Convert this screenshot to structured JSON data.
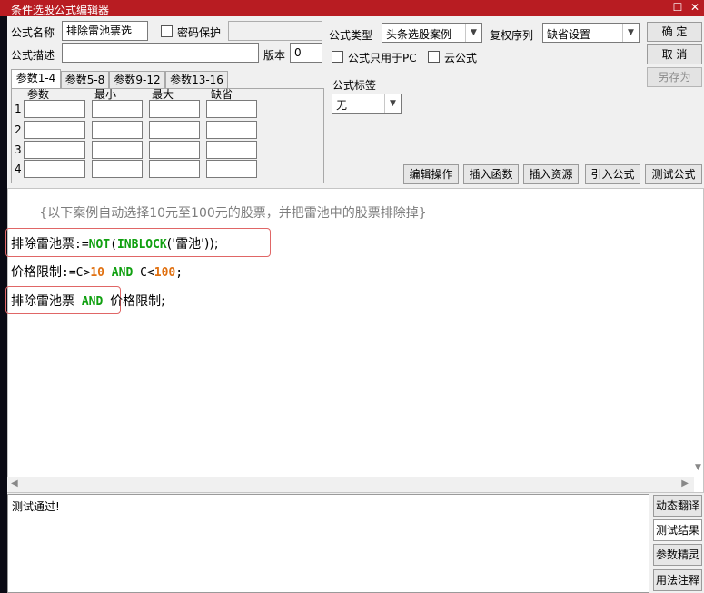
{
  "window": {
    "title": "条件选股公式编辑器",
    "restore_glyph": "☐",
    "close_glyph": "✕"
  },
  "form": {
    "name_label": "公式名称",
    "name_value": "排除雷池票选",
    "password_label": "密码保护",
    "password_value": "",
    "desc_label": "公式描述",
    "desc_value": "",
    "version_label": "版本",
    "version_value": "0",
    "type_label": "公式类型",
    "type_value": "头条选股案例",
    "rights_label": "复权序列",
    "rights_value": "缺省设置",
    "pc_only_label": "公式只用于PC",
    "cloud_label": "云公式",
    "tag_label": "公式标签",
    "tag_value": "无"
  },
  "buttons": {
    "ok": "确  定",
    "cancel": "取  消",
    "save_as": "另存为",
    "edit_ops": "编辑操作",
    "insert_func": "插入函数",
    "insert_res": "插入资源",
    "import_formula": "引入公式",
    "test_formula": "测试公式"
  },
  "params": {
    "tabs": [
      "参数1-4",
      "参数5-8",
      "参数9-12",
      "参数13-16"
    ],
    "headers": [
      "参数",
      "最小",
      "最大",
      "缺省"
    ],
    "rows": [
      "1",
      "2",
      "3",
      "4"
    ]
  },
  "editor": {
    "comment": "{以下案例自动选择10元至100元的股票，并把雷池中的股票排除掉}",
    "line1": {
      "name": "排除雷池票",
      "assign": ":=",
      "fn1": "NOT",
      "paren1": "(",
      "fn2": "INBLOCK",
      "arg": "('雷池'));"
    },
    "line2": {
      "name": "价格限制",
      "assign": ":=",
      "c1": "C>",
      "n1": "10",
      "and": "AND",
      "c2": "C<",
      "n2": "100",
      "end": ";"
    },
    "line3": {
      "name": "排除雷池票",
      "and": "AND",
      "tail": "价格限制;"
    }
  },
  "output": {
    "text": "测试通过!"
  },
  "side_buttons": [
    "动态翻译",
    "测试结果",
    "参数精灵",
    "用法注释"
  ],
  "scroll": {
    "left": "◀",
    "right": "▶"
  },
  "colors": {
    "title_bg": "#b81c22",
    "keyword": "#10a010",
    "number": "#e07010",
    "highlight": "#e06666"
  }
}
